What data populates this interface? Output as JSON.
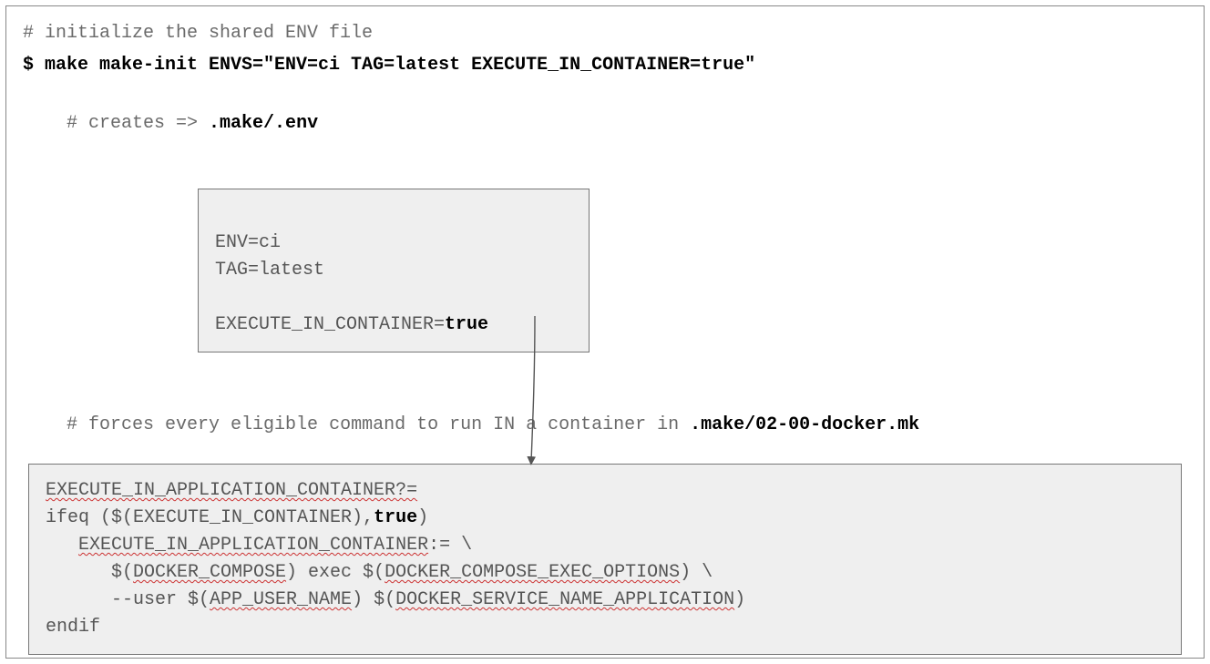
{
  "comments": {
    "c1": "# initialize the shared ENV file",
    "c2_prefix": "# creates => ",
    "c2_path": ".make/.env",
    "c3_prefix": "# forces every eligible command to run IN a container in ",
    "c3_path": ".make/02-00-docker.mk"
  },
  "command": "$ make make-init ENVS=\"ENV=ci TAG=latest EXECUTE_IN_CONTAINER=true\"",
  "env_box": {
    "l1": "ENV=ci",
    "l2": "TAG=latest",
    "l3": "",
    "l4_prefix": "EXECUTE_IN_CONTAINER=",
    "l4_val": "true"
  },
  "mk": {
    "l1": "EXECUTE_IN_APPLICATION_CONTAINER?=",
    "l2": "",
    "l3_pre": "ifeq ($(EXECUTE_IN_CONTAINER),",
    "l3_true": "true",
    "l3_post": ")",
    "l4_indent": "   ",
    "l4_a": "EXECUTE_IN_APPLICATION_CONTAINER",
    "l4_b": ":= \\",
    "l5_indent": "      $(",
    "l5_a": "DOCKER_COMPOSE",
    "l5_mid": ") exec $(",
    "l5_b": "DOCKER_COMPOSE_EXEC_OPTIONS",
    "l5_end": ") \\",
    "l6_indent": "      --user $(",
    "l6_a": "APP_USER_NAME",
    "l6_mid": ") $(",
    "l6_b": "DOCKER_SERVICE_NAME_APPLICATION",
    "l6_end": ")",
    "l7": "endif"
  }
}
